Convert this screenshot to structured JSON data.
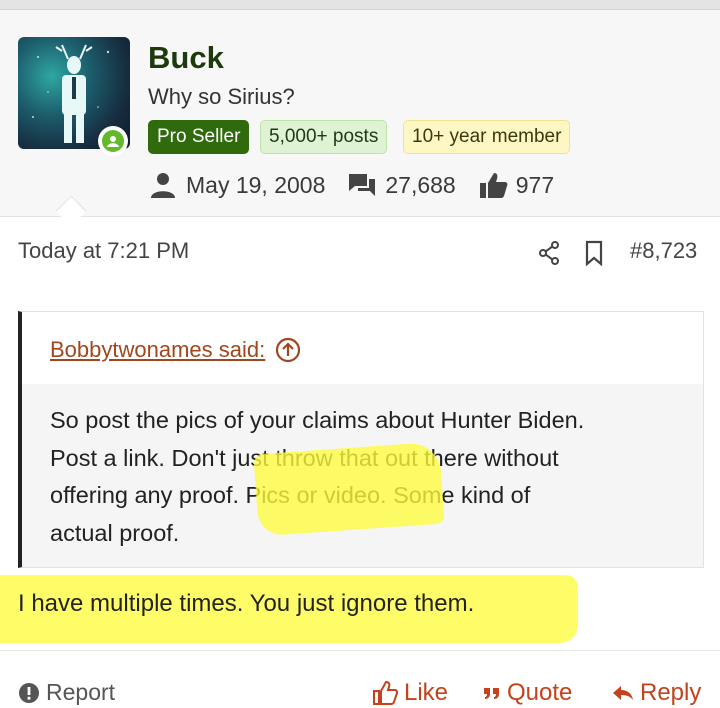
{
  "user": {
    "name": "Buck",
    "title": "Why so Sirius?",
    "badges": [
      "Pro Seller",
      "5,000+ posts",
      "10+ year member"
    ],
    "joined": "May 19, 2008",
    "messages": "27,688",
    "reactions": "977"
  },
  "post": {
    "time": "Today at 7:21 PM",
    "number": "#8,723",
    "quote_author": "Bobbytwonames said:",
    "quote_lines": [
      "So post the pics of your claims about Hunter Biden.",
      "Post a link. Don't just throw that out there without",
      "offering any proof. Pics or video. Some kind of",
      "actual proof."
    ],
    "body": "I have multiple times. You just ignore them."
  },
  "footer": {
    "report": "Report",
    "like": "Like",
    "quote": "Quote",
    "reply": "Reply"
  },
  "colors": {
    "username": "#1d3a0d",
    "pro_badge": "#2f6a0c",
    "action": "#c2431c",
    "highlight": "#fffc3c",
    "online": "#63b92b"
  },
  "icons": [
    "user-icon",
    "messages-icon",
    "thumbs-up-icon",
    "share-icon",
    "bookmark-icon",
    "arrow-up-circle-icon",
    "alert-icon",
    "like-icon",
    "quote-icon",
    "reply-icon"
  ]
}
